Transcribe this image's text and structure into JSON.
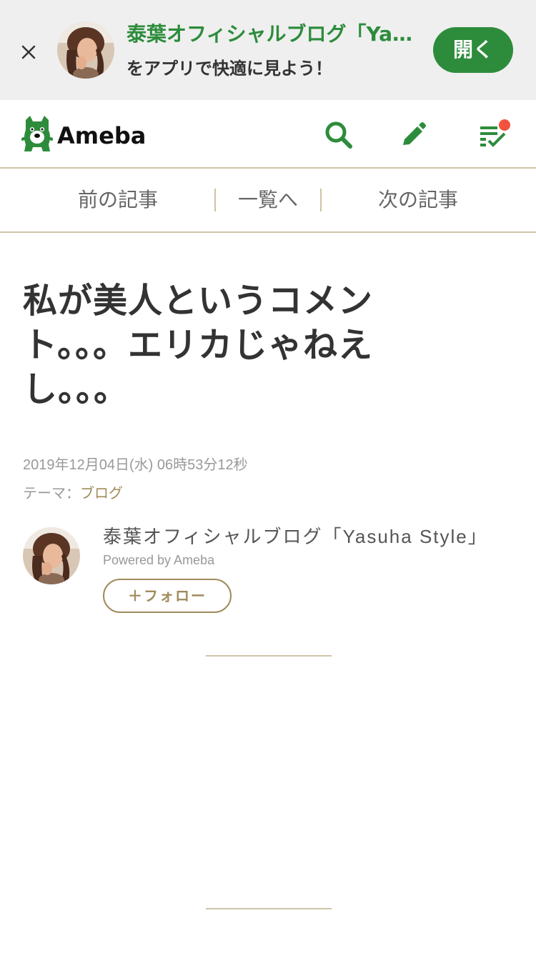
{
  "banner": {
    "title": "泰葉オフィシャルブログ「Yasuha Style」",
    "subtitle": "をアプリで快適に見よう！",
    "open_label": "開く",
    "close_icon": "close-icon",
    "avatar": "author-photo"
  },
  "header": {
    "logo_text": "Ameba",
    "icons": [
      "search-icon",
      "edit-icon",
      "checklist-icon"
    ],
    "brand_color": "#2d8c3c",
    "notification_color": "#f2533e"
  },
  "pager": {
    "prev_label": "前の記事",
    "list_label": "一覧へ",
    "next_label": "次の記事"
  },
  "article": {
    "title": "私が美人というコメント。。。エリカじゃねえし。。。",
    "date": "2019年12月04日(水) 06時53分12秒",
    "theme_prefix": "テーマ：",
    "theme_link": "ブログ"
  },
  "author": {
    "name": "泰葉オフィシャルブログ「Yasuha Style」",
    "powered": "Powered by Ameba",
    "follow_label": "＋フォロー"
  }
}
